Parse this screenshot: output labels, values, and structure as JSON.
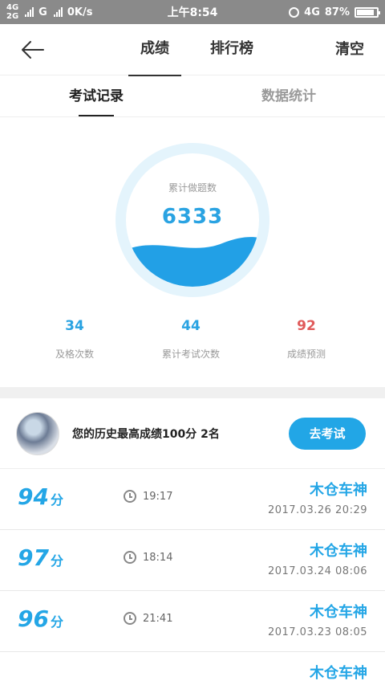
{
  "status_bar": {
    "net1": "4G",
    "net2": "2G",
    "net3": "G",
    "speed": "0K/s",
    "time": "上午8:54",
    "net4": "4G",
    "battery": "87%"
  },
  "nav": {
    "tabs": [
      {
        "label": "成绩",
        "active": true
      },
      {
        "label": "排行榜",
        "active": false
      }
    ],
    "clear_label": "清空"
  },
  "subtabs": [
    {
      "label": "考试记录",
      "active": true
    },
    {
      "label": "数据统计",
      "active": false
    }
  ],
  "summary": {
    "total_label": "累计做题数",
    "total_value": "6333",
    "metrics": [
      {
        "value": "34",
        "label": "及格次数"
      },
      {
        "value": "44",
        "label": "累计考试次数"
      },
      {
        "value": "92",
        "label": "成绩预测"
      }
    ]
  },
  "best": {
    "text": "您的历史最高成绩100分 2名",
    "button_label": "去考试"
  },
  "records": [
    {
      "score": "94",
      "unit": "分",
      "duration": "19:17",
      "name": "木仓车神",
      "date": "2017.03.26 20:29"
    },
    {
      "score": "97",
      "unit": "分",
      "duration": "18:14",
      "name": "木仓车神",
      "date": "2017.03.24 08:06"
    },
    {
      "score": "96",
      "unit": "分",
      "duration": "21:41",
      "name": "木仓车神",
      "date": "2017.03.23 08:05"
    },
    {
      "score": "",
      "unit": "",
      "duration": "",
      "name": "木仓车神",
      "date": ""
    }
  ],
  "colors": {
    "accent": "#24a6e6",
    "prediction": "#e05a5a",
    "ring": "#e4f4fc"
  }
}
